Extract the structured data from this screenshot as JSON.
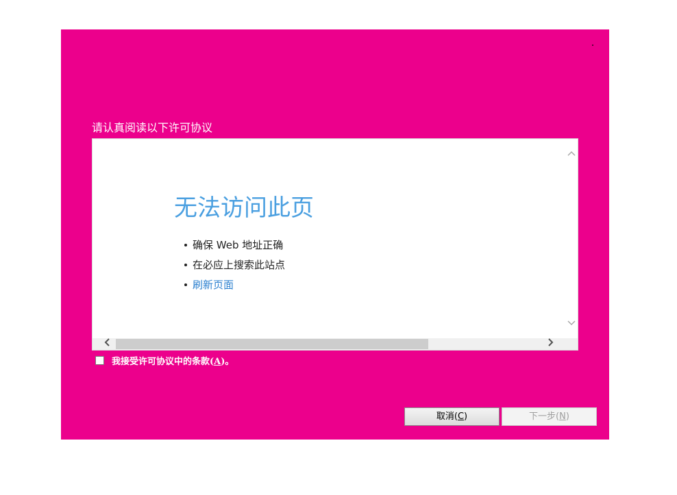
{
  "dialog": {
    "heading": "请认真阅读以下许可协议",
    "accent_color": "#ec008c"
  },
  "viewer": {
    "error_title": "无法访问此页",
    "items": [
      {
        "text": "确保 Web 地址正确"
      },
      {
        "text": "在必应上搜索此站点"
      },
      {
        "text": "刷新页面"
      }
    ],
    "link_color": "#2a7fcf",
    "title_color": "#4a9fe0"
  },
  "accept": {
    "label_prefix": "我接受许可协议中的条款(",
    "label_key": "A",
    "label_suffix": ")。",
    "checked": false
  },
  "buttons": {
    "cancel_prefix": "取消(",
    "cancel_key": "C",
    "cancel_suffix": ")",
    "next_prefix": "下一步(",
    "next_key": "N",
    "next_suffix": ")"
  },
  "icons": {
    "scroll_up": "chevron-up-icon",
    "scroll_down": "chevron-down-icon",
    "scroll_left": "chevron-left-icon",
    "scroll_right": "chevron-right-icon"
  }
}
